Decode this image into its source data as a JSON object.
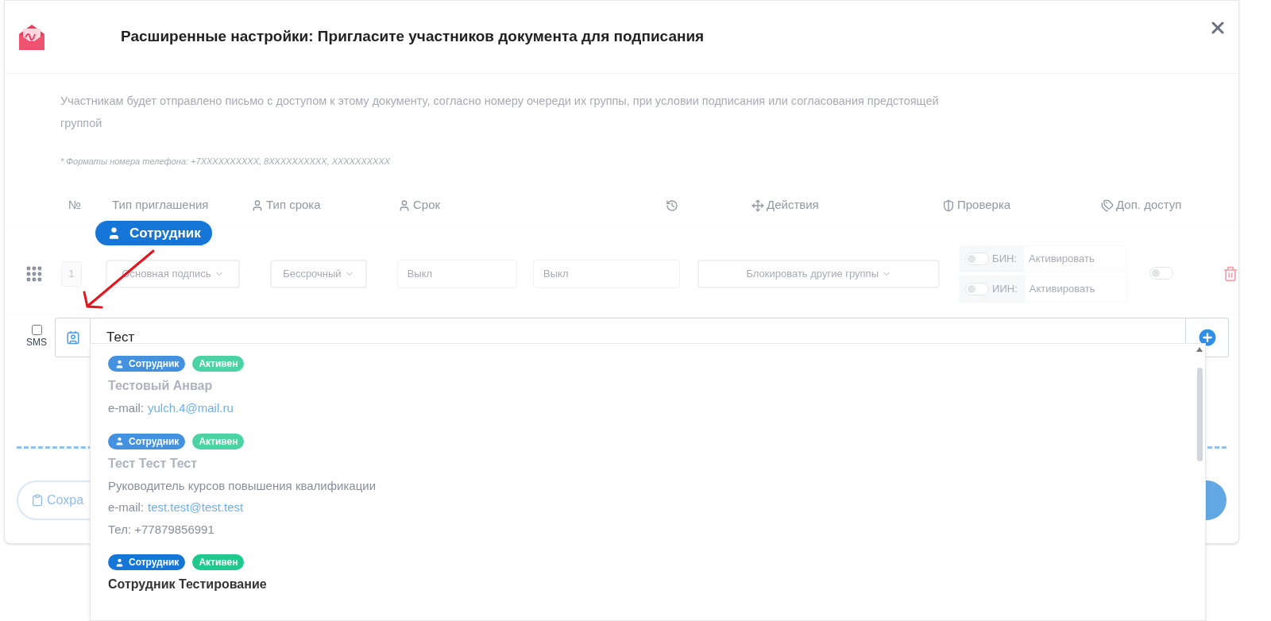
{
  "header": {
    "title": "Расширенные настройки: Пригласите участников документа для подписания"
  },
  "description": "Участникам будет отправлено письмо с доступом к этому документу, согласно номеру очереди их группы, при условии подписания или согласования предстоящей группой",
  "phone_note": "* Форматы номера телефона: +7XXXXXXXXXX, 8XXXXXXXXXX, XXXXXXXXXX",
  "table": {
    "columns": [
      "№",
      "Тип приглашения",
      "Тип срока",
      "Срок",
      "Действия",
      "Проверка",
      "Доп. доступ"
    ],
    "row": {
      "number": "1",
      "invite_type": "Основная подпись",
      "term_type": "Бессрочный",
      "term": "Выкл",
      "column_5": "Выкл",
      "actions": "Блокировать другие группы",
      "checks": [
        {
          "label": "БИН:",
          "placeholder": "Активировать",
          "on": false
        },
        {
          "label": "ИИН:",
          "placeholder": "Активировать",
          "on": false
        }
      ],
      "extra_access_on": false
    }
  },
  "annotation": {
    "label": "Сотрудник"
  },
  "sms": {
    "label": "SMS",
    "checked": false
  },
  "search": {
    "value": "Тест"
  },
  "results": [
    {
      "badges": [
        {
          "kind": "role",
          "label": "Сотрудник"
        },
        {
          "kind": "status",
          "label": "Активен"
        }
      ],
      "name": "Тестовый Анвар",
      "dimmed": true,
      "lines": [
        {
          "kind": "email",
          "label": "e-mail:",
          "value": "yulch.4@mail.ru"
        }
      ]
    },
    {
      "badges": [
        {
          "kind": "role",
          "label": "Сотрудник"
        },
        {
          "kind": "status",
          "label": "Активен"
        }
      ],
      "name": "Тест Тест Тест",
      "dimmed": true,
      "lines": [
        {
          "kind": "text",
          "value": "Руководитель курсов повышения квалификации"
        },
        {
          "kind": "email",
          "label": "e-mail:",
          "value": "test.test@test.test"
        },
        {
          "kind": "text",
          "value": "Тел: +77879856991"
        }
      ]
    },
    {
      "badges": [
        {
          "kind": "role",
          "label": "Сотрудник"
        },
        {
          "kind": "status",
          "label": "Активен"
        }
      ],
      "name": "Сотрудник Тестирование",
      "dimmed": false
    }
  ],
  "footer": {
    "save_button": "Сохра"
  }
}
